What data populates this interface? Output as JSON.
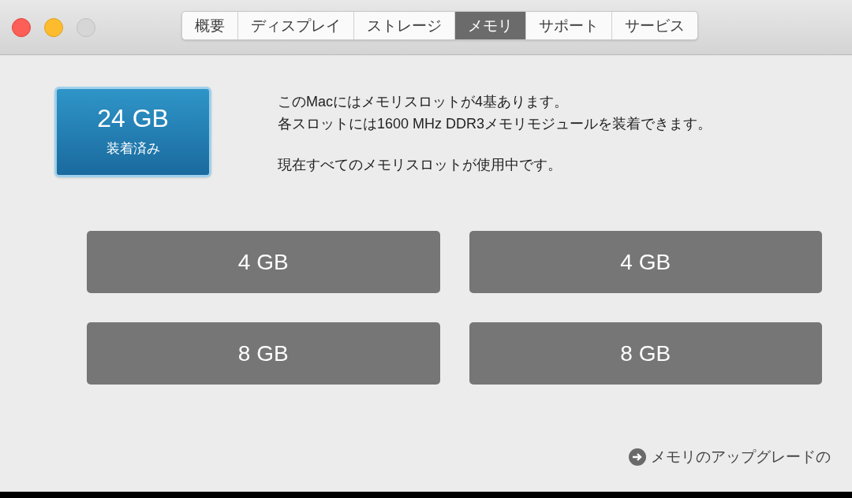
{
  "window": {
    "tabs": [
      {
        "label": "概要",
        "selected": false
      },
      {
        "label": "ディスプレイ",
        "selected": false
      },
      {
        "label": "ストレージ",
        "selected": false
      },
      {
        "label": "メモリ",
        "selected": true
      },
      {
        "label": "サポート",
        "selected": false
      },
      {
        "label": "サービス",
        "selected": false
      }
    ]
  },
  "summary": {
    "total": "24 GB",
    "caption": "装着済み"
  },
  "info": [
    "このMacにはメモリスロットが4基あります。",
    "各スロットには1600 MHz DDR3メモリモジュールを装着できます。",
    "現在すべてのメモリスロットが使用中です。"
  ],
  "slots": [
    "4 GB",
    "4 GB",
    "8 GB",
    "8 GB"
  ],
  "link": "メモリのアップグレードの"
}
